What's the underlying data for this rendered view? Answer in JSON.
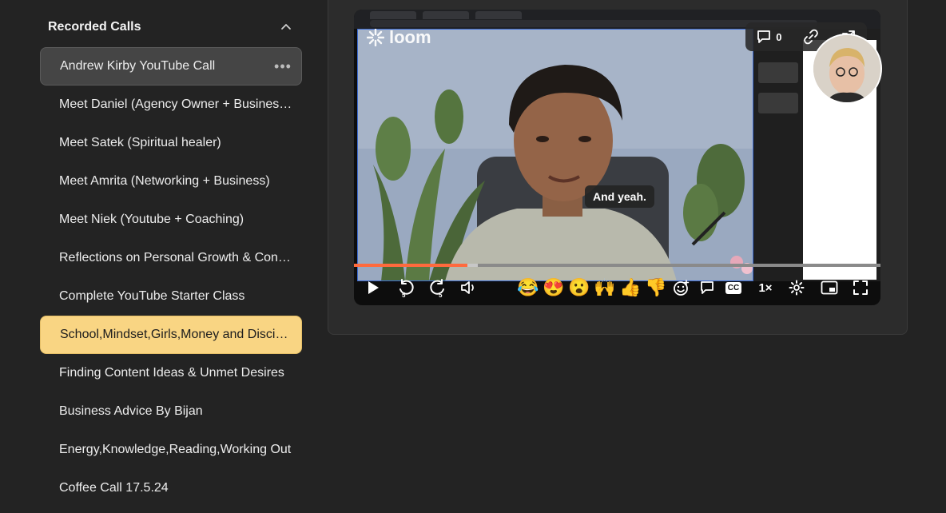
{
  "sidebar": {
    "section_title": "Recorded Calls",
    "items": [
      {
        "label": "Andrew Kirby YouTube Call",
        "state": "active"
      },
      {
        "label": "Meet Daniel (Agency Owner + Business Coach)",
        "state": ""
      },
      {
        "label": "Meet Satek (Spiritual healer)",
        "state": ""
      },
      {
        "label": "Meet Amrita (Networking + Business)",
        "state": ""
      },
      {
        "label": "Meet Niek (Youtube + Coaching)",
        "state": ""
      },
      {
        "label": "Reflections on Personal Growth & Content Creation",
        "state": ""
      },
      {
        "label": "Complete YouTube Starter Class",
        "state": ""
      },
      {
        "label": "School,Mindset,Girls,Money and Discipline",
        "state": "highlight"
      },
      {
        "label": "Finding Content Ideas & Unmet Desires",
        "state": ""
      },
      {
        "label": "Business Advice By Bijan",
        "state": ""
      },
      {
        "label": "Energy,Knowledge,Reading,Working Out",
        "state": ""
      },
      {
        "label": "Coffee Call 17.5.24",
        "state": ""
      }
    ],
    "more_icon": "more-horizontal-icon",
    "collapse_icon": "chevron-up-icon"
  },
  "player": {
    "brand": "loom",
    "comment_count": "0",
    "caption": "And yeah.",
    "progress_fraction": 0.215,
    "buffered_fraction": 0.235,
    "skip_back_seconds": "5",
    "skip_forward_seconds": "5",
    "cc_label": "CC",
    "speed_label": "1×",
    "reactions": [
      "😂",
      "😍",
      "😮",
      "🙌",
      "👍",
      "👎"
    ]
  },
  "colors": {
    "background": "#232323",
    "panel": "#2c2c2c",
    "active_item": "#454545",
    "highlight_item": "#f9d583",
    "progress": "#ff6a3d"
  }
}
